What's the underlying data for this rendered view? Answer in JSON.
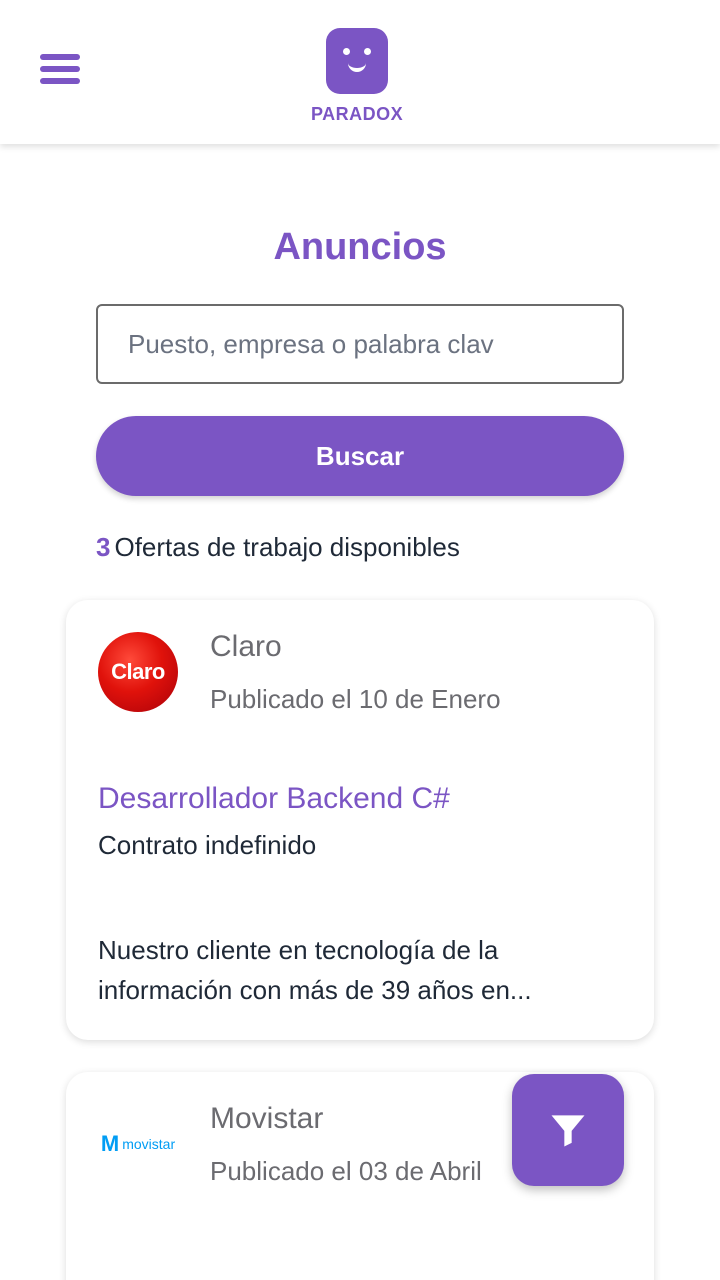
{
  "header": {
    "menu_icon": "hamburger-menu-icon",
    "brand": "PARADOX",
    "accent_color": "#7b55c4"
  },
  "main": {
    "title": "Anuncios",
    "search": {
      "placeholder": "Puesto, empresa o palabra clav",
      "value": ""
    },
    "search_button": "Buscar",
    "results": {
      "count": "3",
      "label": "Ofertas de trabajo disponibles"
    }
  },
  "jobs": [
    {
      "company": "Claro",
      "logo_text": "Claro",
      "published": "Publicado el 10 de Enero",
      "title": "Desarrollador Backend C#",
      "contract": "Contrato indefinido",
      "description": "Nuestro cliente en tecnología de la información con más de 39 años en..."
    },
    {
      "company": "Movistar",
      "logo_text": "movistar",
      "published": "Publicado el 03 de Abril"
    }
  ],
  "fab": {
    "icon": "filter-icon"
  }
}
